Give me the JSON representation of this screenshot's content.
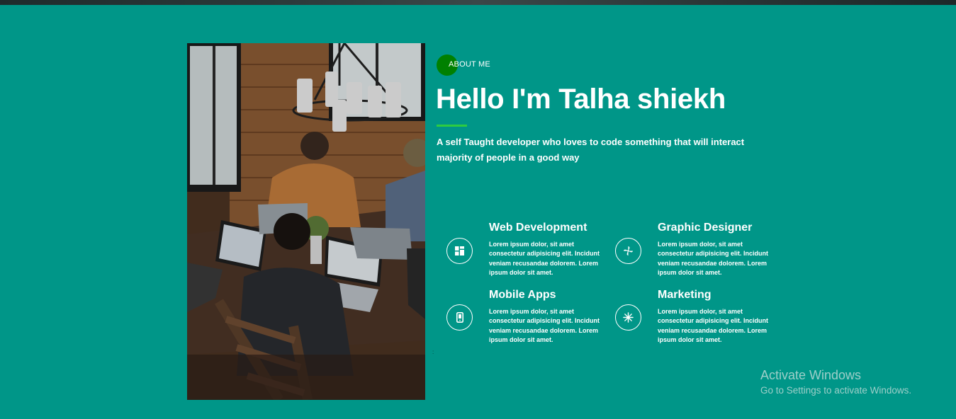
{
  "about": {
    "badge_label": "ABOUT ME",
    "title": "Hello I'm Talha shiekh",
    "intro": "A self Taught developer who loves to code something that will interact majority of people in a good way"
  },
  "photo": {
    "alt": "Team working on laptops around a wooden table"
  },
  "services": [
    {
      "title": "Web Development",
      "icon": "grid-icon",
      "description": "Lorem ipsum dolor, sit amet consectetur adipisicing elit. Incidunt veniam recusandae dolorem. Lorem ipsum dolor sit amet."
    },
    {
      "title": "Graphic Designer",
      "icon": "pinwheel-icon",
      "description": "Lorem ipsum dolor, sit amet consectetur adipisicing elit. Incidunt veniam recusandae dolorem. Lorem ipsum dolor sit amet."
    },
    {
      "title": "Mobile Apps",
      "icon": "mobile-icon",
      "description": "Lorem ipsum dolor, sit amet consectetur adipisicing elit. Incidunt veniam recusandae dolorem. Lorem ipsum dolor sit amet."
    },
    {
      "title": "Marketing",
      "icon": "snowflake-icon",
      "description": "Lorem ipsum dolor, sit amet consectetur adipisicing elit. Incidunt veniam recusandae dolorem. Lorem ipsum dolor sit amet."
    }
  ],
  "stray_mark": ":",
  "watermark": {
    "title": "Activate Windows",
    "subtitle": "Go to Settings to activate Windows."
  },
  "colors": {
    "background": "#009688",
    "accent_green": "#2ecc40",
    "badge_green": "#008000"
  }
}
